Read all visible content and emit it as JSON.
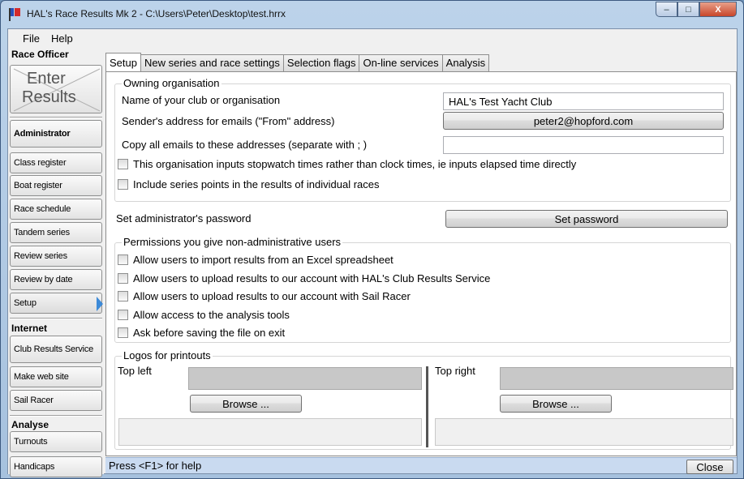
{
  "window": {
    "title": "HAL's Race Results Mk 2 - C:\\Users\\Peter\\Desktop\\test.hrrx",
    "minimize_label": "–",
    "maximize_label": "□",
    "close_label": "X"
  },
  "menu": {
    "file": "File",
    "help": "Help"
  },
  "sidebar": {
    "race_officer_heading": "Race Officer",
    "enter_results_line1": "Enter",
    "enter_results_line2": "Results",
    "administrator": "Administrator",
    "items": [
      "Class register",
      "Boat register",
      "Race schedule",
      "Tandem series",
      "Review series",
      "Review by date",
      "Setup"
    ],
    "internet_heading": "Internet",
    "internet_items": [
      "Club Results Service",
      "Make web site",
      "Sail Racer"
    ],
    "analyse_heading": "Analyse",
    "analyse_items": [
      "Turnouts",
      "Handicaps"
    ]
  },
  "tabs": [
    "Setup",
    "New series and race settings",
    "Selection flags",
    "On-line services",
    "Analysis"
  ],
  "owning": {
    "group_label": "Owning organisation",
    "club_name_label": "Name of your club or organisation",
    "club_name_value": "HAL's Test Yacht Club",
    "sender_label": "Sender's address for emails (\"From\" address)",
    "sender_value": "peter2@hopford.com",
    "copy_label": "Copy all emails to these addresses (separate with ; )",
    "copy_value": "",
    "stopwatch_label": "This organisation inputs stopwatch times rather than clock times, ie inputs elapsed time directly",
    "series_points_label": "Include series points in the results of individual races"
  },
  "password": {
    "label": "Set administrator's password",
    "button": "Set password"
  },
  "permissions": {
    "group_label": "Permissions you give non-administrative users",
    "items": [
      "Allow users to import results from an Excel spreadsheet",
      "Allow users to upload results to our account with HAL's Club Results Service",
      "Allow users to upload results to our account with Sail Racer",
      "Allow access to the analysis tools",
      "Ask before saving the file on exit"
    ]
  },
  "logos": {
    "group_label": "Logos for printouts",
    "top_left_label": "Top left",
    "top_right_label": "Top right",
    "browse_label": "Browse ..."
  },
  "status": {
    "help_text": "Press <F1> for help",
    "close_label": "Close"
  }
}
